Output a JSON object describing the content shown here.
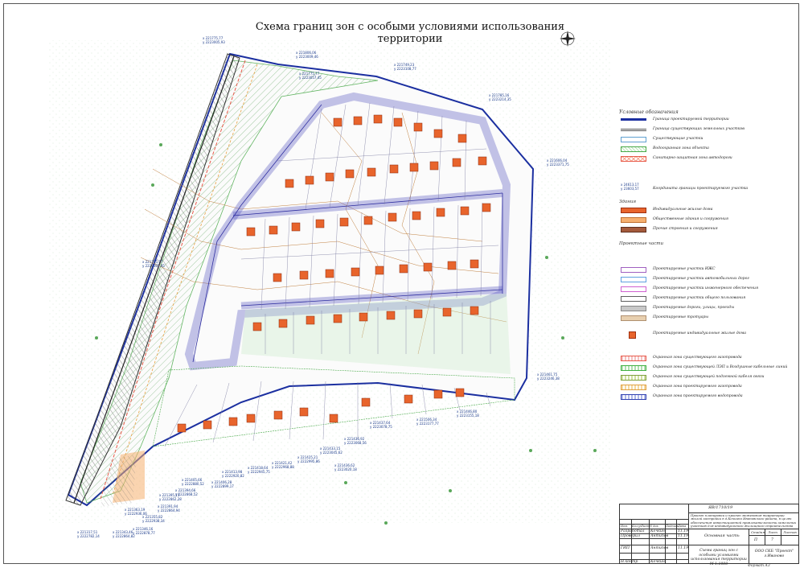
{
  "title": "Схема границ зон с особыми условиями использования территории",
  "legend": {
    "header": "Условные обозначения",
    "items": [
      {
        "label": "Граница проектируемой территории"
      },
      {
        "label": "Граница существующих земельных участков"
      },
      {
        "label": "Существующие участки"
      },
      {
        "label": "Водоохранная зона объекта"
      },
      {
        "label": "Санитарно-защитная зона автодороги"
      },
      {
        "label": "Координата границы проектируемого участка"
      }
    ],
    "coord_example": {
      "x": "х 24613,17",
      "y": "у 23603,57"
    },
    "sect_buildings": "Здания",
    "buildings": [
      {
        "label": "Индивидуальные жилые дома",
        "color": "#e8642c"
      },
      {
        "label": "Общественные здания и сооружения",
        "color": "#f5b070"
      },
      {
        "label": "Прочие строения и сооружения",
        "color": "#a45a3c"
      }
    ],
    "sect_projected": "Проектные части",
    "projected": [
      {
        "label": "Проектируемые участки ИЖС"
      },
      {
        "label": "Проектируемые участки автомобильных дорог"
      },
      {
        "label": "Проектируемые участки инженерного обеспечения"
      },
      {
        "label": "Проектируемые участки общего пользования"
      },
      {
        "label": "Проектируемые дороги, улицы, проезды"
      },
      {
        "label": "Проектируемые тротуары"
      },
      {
        "label": "Проектируемые индивидуальные жилые дома"
      }
    ],
    "zones": [
      {
        "label": "Охранная зона существующего газопровода"
      },
      {
        "label": "Охранная зона существующей ЛЭП и Воздушные кабельные линий"
      },
      {
        "label": "Охранная зона существующей подземной кабеля связи"
      },
      {
        "label": "Охранная зона проектируемого газопровода"
      },
      {
        "label": "Охранная зона проектируемого водопровода"
      }
    ]
  },
  "coords": [
    {
      "x": "х 221775,77",
      "y": "у 2223005,93"
    },
    {
      "x": "х 221806,06",
      "y": "у 2223009,46"
    },
    {
      "x": "х 221775,77",
      "y": "у 2223057,45"
    },
    {
      "x": "х 221749,23",
      "y": "у 2223108,77"
    },
    {
      "x": "х 221785,16",
      "y": "у 2223214,35"
    },
    {
      "x": "х 221606,04",
      "y": "у 2223371,75"
    },
    {
      "x": "х 221775,77",
      "y": "у 2223005,45"
    },
    {
      "x": "х 221461,75",
      "y": "у 2223246,38"
    },
    {
      "x": "х 221446,80",
      "y": "у 2223155,18"
    },
    {
      "x": "х 221506,34",
      "y": "у 2223177,77"
    },
    {
      "x": "х 221437,64",
      "y": "у 2223078,75"
    },
    {
      "x": "х 221436,92",
      "y": "у 2223068,56"
    },
    {
      "x": "х 221433,15",
      "y": "у 2223045,62"
    },
    {
      "x": "х 221436,62",
      "y": "у 2223020,18"
    },
    {
      "x": "х 221425,21",
      "y": "у 2222995,86"
    },
    {
      "x": "х 221421,42",
      "y": "у 2222968,88"
    },
    {
      "x": "х 221418,64",
      "y": "у 2222945,75"
    },
    {
      "x": "х 221413,98",
      "y": "у 2222920,82"
    },
    {
      "x": "х 221406,28",
      "y": "у 2222899,17"
    },
    {
      "x": "х 221405,66",
      "y": "у 2222880,52"
    },
    {
      "x": "х 221394,66",
      "y": "у 2222868,52"
    },
    {
      "x": "х 221395,15",
      "y": "у 2222862,28"
    },
    {
      "x": "х 221391,94",
      "y": "у 2222864,94"
    },
    {
      "x": "х 221355,82",
      "y": "у 2222938,34"
    },
    {
      "x": "х 221363,19",
      "y": "у 2222936,06"
    },
    {
      "x": "х 221346,16",
      "y": "у 2222878,77"
    },
    {
      "x": "х 221343,46",
      "y": "у 2222864,82"
    },
    {
      "x": "х 221317,51",
      "y": "у 2222782,14"
    }
  ],
  "title_block": {
    "code": "ЯВ/1710/19",
    "project": "Проект планировки и проект межевания территории жилой застройки в д.Кочкино Ивановского района, в целях обеспечения инвестиционной привлекательности земельных участков для индивидуального жилищного строительства",
    "hdr_izm": "Изм.",
    "hdr_kol": "Кол.уч",
    "hdr_list": "Лист",
    "hdr_doc": "N док.",
    "hdr_sign": "Подпись",
    "hdr_date": "Дата",
    "role1": "Разработал",
    "name1": "Кочкин",
    "role2": "Проверил",
    "name2": "Антипов",
    "role3": "ГИП",
    "name3": "Антипов",
    "role4": "Н.контр",
    "name4": "Кочкин",
    "date": "11.19",
    "section": "Основная часть",
    "stage_h": "Стадия",
    "sheet_h": "Лист",
    "sheets_h": "Листов",
    "stage": "П",
    "sheet": "7",
    "sheets": "",
    "drawing": "Схема границ зон с особыми условиями использования территории М 1:1000",
    "org": "ООО СКБ \"Проект\" г.Иваново"
  },
  "format": "Формат А3",
  "colors": {
    "boundary": "#1b2fa0",
    "house": "#e8642c",
    "road": "#8c8cd8",
    "water_zone": "#5cc85c",
    "sanitary": "#e85a4a"
  }
}
